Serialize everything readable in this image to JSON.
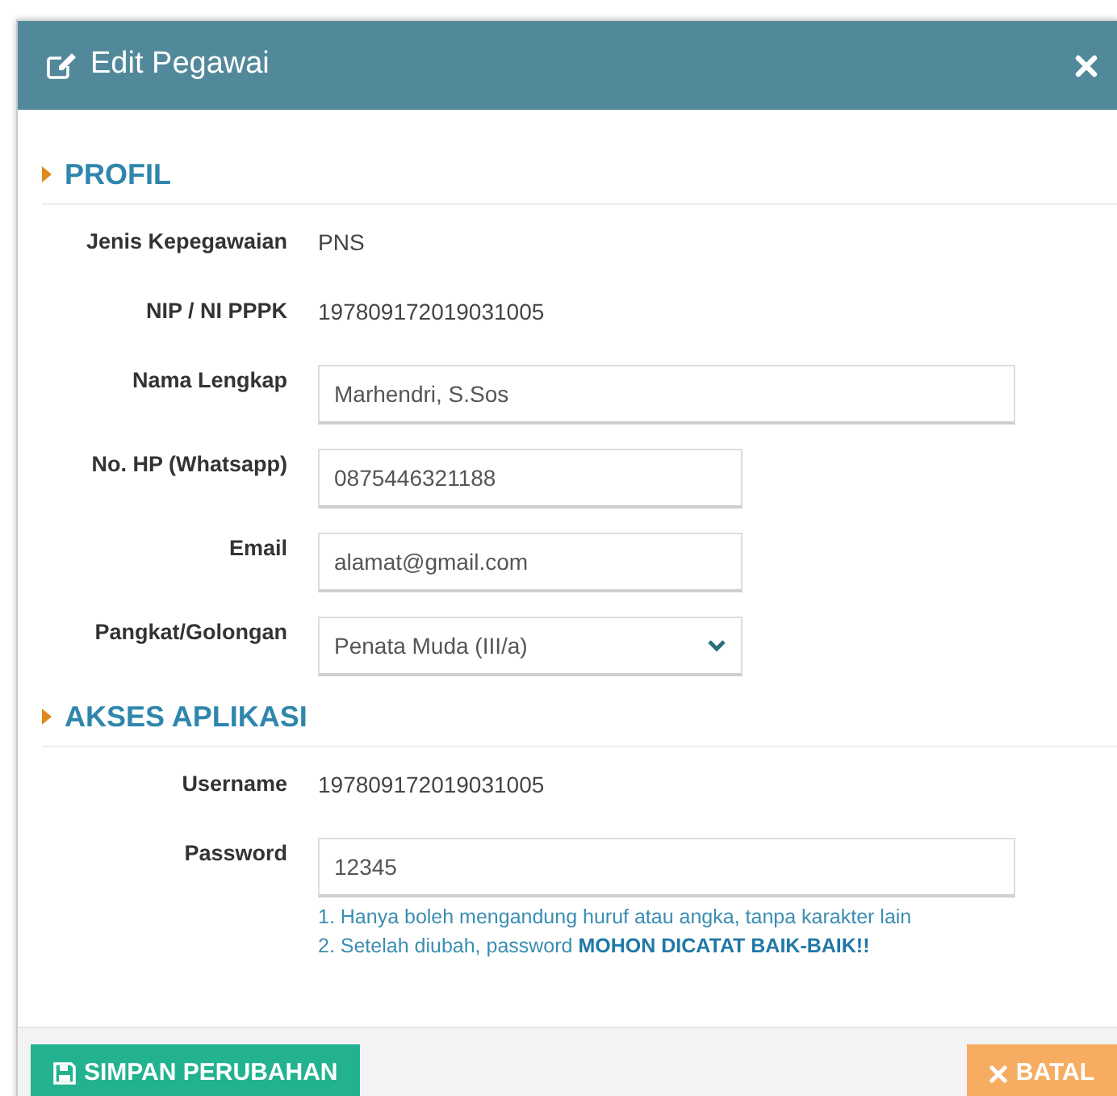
{
  "dialog": {
    "title": "Edit Pegawai"
  },
  "sections": [
    {
      "title": "PROFIL",
      "fields": [
        {
          "label": "Jenis Kepegawaian",
          "kind": "text",
          "value": "PNS"
        },
        {
          "label": "NIP / NI PPPK",
          "kind": "text",
          "value": "197809172019031005"
        },
        {
          "label": "Nama Lengkap",
          "kind": "input",
          "wide": true,
          "value": "Marhendri, S.Sos"
        },
        {
          "label": "No. HP (Whatsapp)",
          "kind": "input",
          "wide": false,
          "value": "0875446321188"
        },
        {
          "label": "Email",
          "kind": "input",
          "wide": false,
          "value": "alamat@gmail.com"
        },
        {
          "label": "Pangkat/Golongan",
          "kind": "select",
          "wide": false,
          "value": "Penata Muda (III/a)"
        }
      ]
    },
    {
      "title": "AKSES APLIKASI",
      "fields": [
        {
          "label": "Username",
          "kind": "text",
          "value": "197809172019031005"
        },
        {
          "label": "Password",
          "kind": "input",
          "wide": true,
          "value": "12345",
          "notes": [
            "1. Hanya boleh mengandung huruf atau angka, tanpa karakter lain",
            "2. Setelah diubah, password **MOHON DICATAT BAIK-BAIK!!**"
          ]
        }
      ]
    }
  ],
  "buttons": [
    {
      "label": "SIMPAN PERUBAHAN",
      "kind": "save"
    },
    {
      "label": "BATAL",
      "kind": "cancel"
    }
  ]
}
